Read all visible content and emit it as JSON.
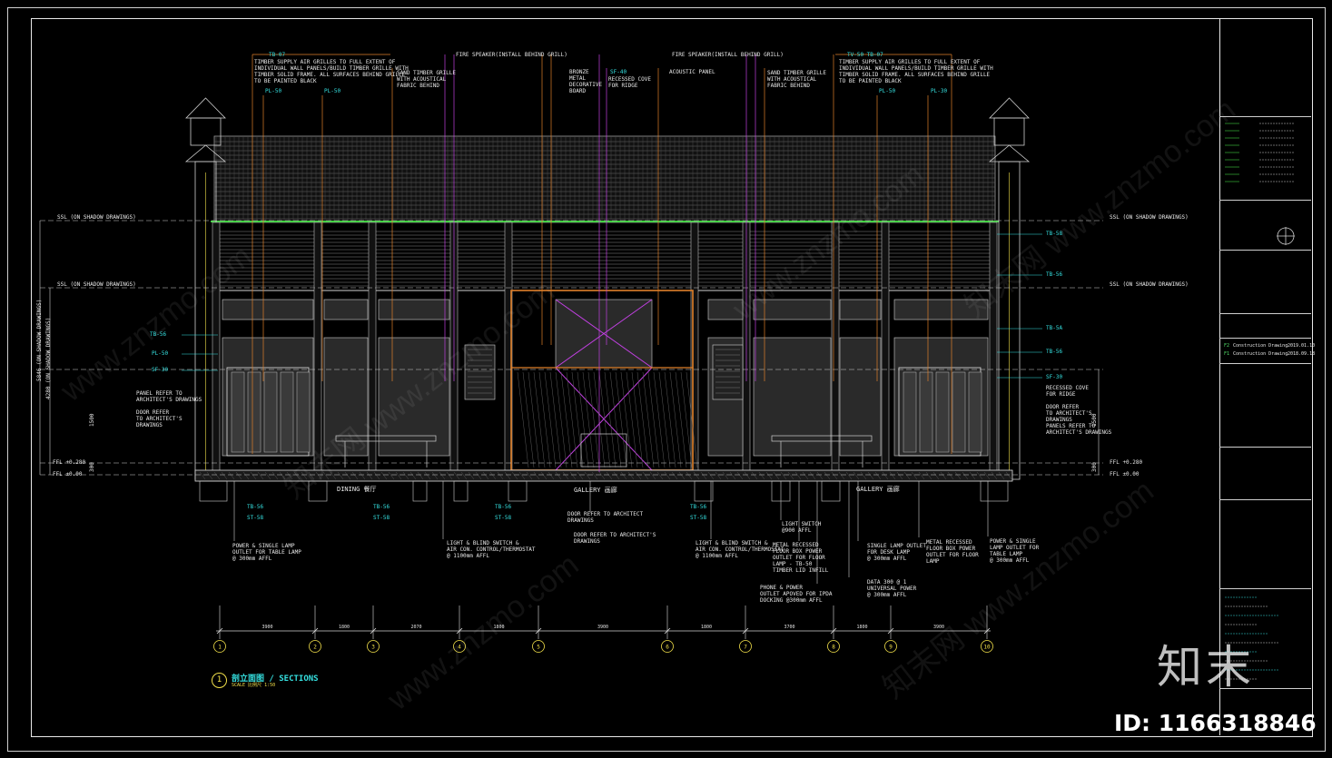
{
  "drawing": {
    "section_number": "1",
    "section_title": "剖立面图 / SECTIONS",
    "section_scale": "SCALE 比例尺 1:50"
  },
  "levels": {
    "upper_left": "SSL (ON SHADOW DRAWINGS)",
    "mid_left": "SSL (ON SHADOW DRAWINGS)",
    "upper_right": "SSL (ON SHADOW DRAWINGS)",
    "mid_right": "SSL (ON SHADOW DRAWINGS)",
    "ffl_left_1": "FFL +0.280",
    "ffl_left_2": "FFL ±0.00",
    "ffl_right_1": "FFL +0.280",
    "ffl_right_2": "FFL ±0.00"
  },
  "annotations_top": [
    "TIMBER SUPPLY AIR GRILLES TO FULL EXTENT OF\nINDIVIDUAL WALL PANELS/BUILD TIMBER GRILLE WITH\nTIMBER SOLID FRAME. ALL SURFACES BEHIND GRILLE\nTO BE PAINTED BLACK",
    "SAND TIMBER GRILLE\nWITH ACOUSTICAL\nFABRIC BEHIND",
    "FIRE SPEAKER(INSTALL BEHIND GRILL)",
    "BRONZE\nMETAL\nDECORATIVE\nBOARD",
    "RECESSED COVE\nFOR RIDGE",
    "ACOUSTIC PANEL",
    "FIRE SPEAKER(INSTALL BEHIND GRILL)",
    "SAND TIMBER GRILLE\nWITH ACOUSTICAL\nFABRIC BEHIND",
    "TIMBER SUPPLY AIR GRILLES TO FULL EXTENT OF\nINDIVIDUAL WALL PANELS/BUILD TIMBER GRILLE WITH\nTIMBER SOLID FRAME. ALL SURFACES BEHIND GRILLE\nTO BE PAINTED BLACK"
  ],
  "tags_top": [
    "TB-07",
    "PL-50",
    "PL-50",
    "SF-40",
    "TV-50 TB-07",
    "PL-50",
    "PL-30"
  ],
  "tags_side_right": [
    "TB-58",
    "TB-56",
    "TB-5A",
    "TB-56",
    "SF-30"
  ],
  "tags_side_left": [
    "TB-56",
    "PL-50",
    "SF-30"
  ],
  "side_notes": {
    "left": "PANEL REFER TO\nARCHITECT'S DRAWINGS\n\nDOOR REFER\nTO ARCHITECT'S\nDRAWINGS",
    "right": "RECESSED COVE\nFOR RIDGE\n\nDOOR REFER\nTO ARCHITECT'S\nDRAWINGS\nPANELS REFER TO\nARCHITECT'S DRAWINGS"
  },
  "rooms": [
    "DINING 餐厅",
    "GALLERY 画廊",
    "GALLERY 画廊"
  ],
  "annotations_bottom": [
    "POWER & SINGLE LAMP\nOUTLET FOR TABLE LAMP\n@ 300mm AFFL",
    "LIGHT & BLIND SWITCH &\nAIR CON. CONTROL/THERMOSTAT\n@ 1100mm AFFL",
    "DOOR REFER TO ARCHITECT\nDRAWINGS",
    "DOOR REFER TO ARCHITECT'S\nDRAWINGS",
    "LIGHT & BLIND SWITCH &\nAIR CON. CONTROL/THERMOSTAT\n@ 1100mm AFFL",
    "LIGHT SWITCH\n@900 AFFL",
    "METAL RECESSED\nFLOOR BOX POWER\nOUTLET FOR FLOOR\nLAMP - TB-50\nTIMBER LID INFILL",
    "PHONE & POWER\nOUTLET APOVED FOR IPDA\nDOCKING @300mm AFFL",
    "SINGLE LAMP OUTLET\nFOR DESK LAMP\n@ 300mm AFFL",
    "DATA 300 @ 1\nUNIVERSAL POWER\n@ 300mm AFFL",
    "METAL RECESSED\nFLOOR BOX POWER\nOUTLET FOR FLOOR\nLAMP",
    "POWER & SINGLE\nLAMP OUTLET FOR\nTABLE LAMP\n@ 300mm AFFL"
  ],
  "tags_bottom": [
    "TB-56",
    "ST-58",
    "TB-56",
    "ST-58",
    "TB-56",
    "ST-58",
    "TB-56",
    "ST-58"
  ],
  "grid": {
    "bubbles": [
      "1",
      "2",
      "3",
      "4",
      "5",
      "6",
      "7",
      "8",
      "9",
      "10"
    ],
    "dimensions": [
      "3900",
      "1800",
      "2070",
      "1800",
      "3900",
      "1800",
      "3700",
      "1800",
      "3900"
    ]
  },
  "vertical_dims": [
    "5846 (ON SHADOW DRAWINGS)",
    "4280 (ON SHADOW DRAWINGS)",
    "1500",
    "300",
    "1500",
    "300"
  ],
  "title_block": {
    "revisions": [
      {
        "code": "F2",
        "desc": "Construction Drawing",
        "date": "2019.01.10"
      },
      {
        "code": "F1",
        "desc": "Construction Drawing",
        "date": "2018.09.18"
      }
    ]
  },
  "watermarks": [
    "www.znzmo.com",
    "知末网 www.znzmo.com"
  ],
  "brand": {
    "logo": "知末",
    "id_text": "ID: 1166318846"
  },
  "colors": {
    "background": "#000000",
    "frame": "#e0e0e0",
    "cyan": "#35e0e0",
    "yellow": "#f2e04a",
    "orange": "#e0802a",
    "magenta": "#c040e0",
    "green": "#40d040"
  }
}
